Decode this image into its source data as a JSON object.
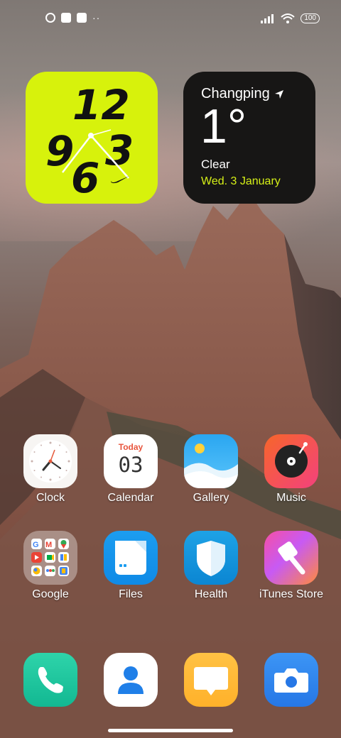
{
  "status_bar": {
    "left_icons": [
      "app-notification-icon",
      "square-notification-icon",
      "upload-notification-icon"
    ],
    "more": "··",
    "battery": "100"
  },
  "nike_widget": {
    "digits": [
      "12",
      "9",
      "6",
      "3"
    ],
    "accent": "#d7f20c"
  },
  "weather_widget": {
    "city": "Changping",
    "temperature": "1°",
    "condition": "Clear",
    "date": "Wed. 3 January"
  },
  "apps": [
    {
      "label": "Clock",
      "icon": "clock-icon"
    },
    {
      "label": "Calendar",
      "icon": "calendar-icon",
      "top_text": "Today",
      "day": "03"
    },
    {
      "label": "Gallery",
      "icon": "gallery-icon"
    },
    {
      "label": "Music",
      "icon": "music-icon"
    },
    {
      "label": "Google",
      "icon": "google-folder-icon"
    },
    {
      "label": "Files",
      "icon": "files-icon"
    },
    {
      "label": "Health",
      "icon": "health-shield-icon"
    },
    {
      "label": "iTunes Store",
      "icon": "itunes-store-icon"
    }
  ],
  "dock": [
    {
      "icon": "phone-icon"
    },
    {
      "icon": "contacts-icon"
    },
    {
      "icon": "messages-icon"
    },
    {
      "icon": "camera-icon"
    }
  ]
}
